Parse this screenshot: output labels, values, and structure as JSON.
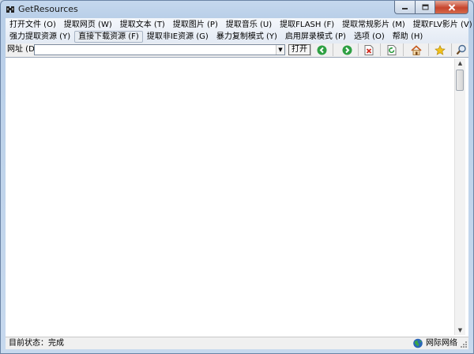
{
  "window": {
    "title": "GetResources",
    "controls": {
      "minimize": "minimize",
      "maximize": "maximize",
      "close": "close"
    }
  },
  "menu": {
    "row1": [
      "打开文件 (O)",
      "提取网页 (W)",
      "提取文本 (T)",
      "提取图片 (P)",
      "提取音乐 (U)",
      "提取FLASH (F)",
      "提取常规影片 (M)",
      "提取FLV影片 (V)"
    ],
    "row2": [
      "强力提取资源 (Y)",
      "直接下载资源 (F)",
      "提取非IE资源 (G)",
      "暴力复制模式 (Y)",
      "启用屏录模式 (P)",
      "选项 (O)",
      "帮助 (H)"
    ]
  },
  "address_bar": {
    "label": "网址 (D)",
    "value": "",
    "open_label": "打开"
  },
  "toolbar_icons": [
    "back-icon",
    "forward-icon",
    "stop-icon",
    "refresh-icon",
    "home-icon",
    "favorites-icon",
    "search-icon"
  ],
  "status": {
    "text": "目前状态：完成",
    "zone": "网际网络"
  },
  "colors": {
    "accent": "#2b5797",
    "close_button": "#c7442d",
    "nav_green": "#2ea043"
  }
}
